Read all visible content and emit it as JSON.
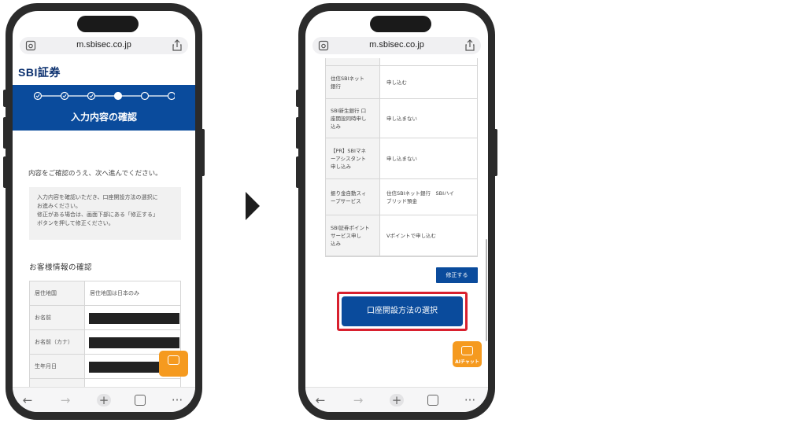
{
  "browser": {
    "url": "m.sbisec.co.jp"
  },
  "screen1": {
    "logo": "SBI証券",
    "header_title": "入力内容の確認",
    "steps_total": 6,
    "steps_completed": 3,
    "current_step": 4,
    "intro_text": "内容をご確認のうえ、次へ進んでください。",
    "note_lines": [
      "入力内容を確認いただき、口座開設方法の選択に",
      "お進みください。",
      "修正がある場合は、画面下部にある「修正する」",
      "ボタンを押して修正ください。"
    ],
    "section_title": "お客様情報の確認",
    "rows": [
      {
        "label": "居住地国",
        "value": "居住地国は日本のみ",
        "redacted": false
      },
      {
        "label": "お名前",
        "value": "",
        "redacted": true
      },
      {
        "label": "お名前（カナ）",
        "value": "",
        "redacted": true
      },
      {
        "label": "生年月日",
        "value": "",
        "redacted": true
      },
      {
        "label": "",
        "value": "",
        "redacted": false
      }
    ]
  },
  "screen2": {
    "rows": [
      {
        "label": [],
        "value": ""
      },
      {
        "label": [
          "住信SBIネット",
          "銀行"
        ],
        "value": "申し込む"
      },
      {
        "label": [
          "SBI新生銀行 口",
          "座開設同時申し",
          "込み"
        ],
        "value": "申し込まない"
      },
      {
        "label": [
          "【PR】SBIマネ",
          "ーアシスタント",
          "申し込み"
        ],
        "value": "申し込まない"
      },
      {
        "label": [
          "振り金自動スィ",
          "ープサービス"
        ],
        "value": [
          "住信SBIネット銀行　SBIハイ",
          "ブリッド預金"
        ]
      },
      {
        "label": [
          "SBI証券ポイント",
          "サービス申し",
          "込み"
        ],
        "value": "Vポイントで申し込む"
      }
    ],
    "fix_button": "修正する",
    "primary_button": "口座開設方法の選択"
  },
  "ai_chat_label": "AIチャット",
  "colors": {
    "brand_blue": "#0a4b9c",
    "highlight_red": "#d8202e",
    "ai_orange": "#f59a1f"
  },
  "icons": [
    "camera-scan-icon",
    "share-icon",
    "back-icon",
    "forward-icon",
    "new-tab-icon",
    "tabs-icon",
    "more-icon",
    "robot-icon"
  ]
}
